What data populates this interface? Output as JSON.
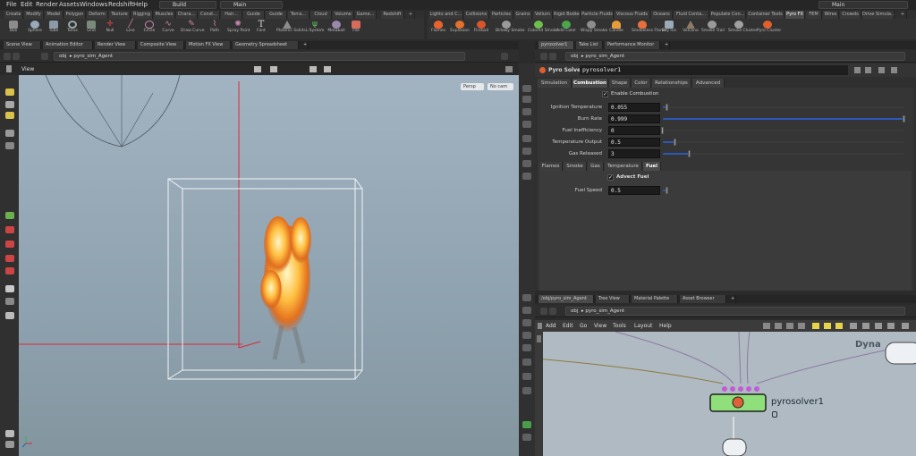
{
  "menubar": {
    "items": [
      "File",
      "Edit",
      "Render",
      "Assets",
      "Windows",
      "Redshift",
      "Help"
    ],
    "desktop": "Build",
    "main_label": "Main",
    "right_main": "Main"
  },
  "shelf_tabs_left": [
    "Create",
    "Modify",
    "Model",
    "Polygon",
    "Deform",
    "Texture",
    "Rigging",
    "Muscles",
    "Chara...",
    "Const...",
    "Hair...",
    "Guide",
    "Guide",
    "Terra...",
    "Cloud",
    "Volume",
    "Game...",
    "Redshift"
  ],
  "shelf_tabs_right": [
    "Lights and C...",
    "Collisions",
    "Particles",
    "Grains",
    "Vellum",
    "Rigid Bodies",
    "Particle Fluids",
    "Viscous Fluids",
    "Oceans",
    "Fluid Conta...",
    "Populate Con...",
    "Container Tools",
    "Pyro FX",
    "FEM",
    "Wires",
    "Crowds",
    "Drive Simula..."
  ],
  "tools_left": [
    "Box",
    "Sphere",
    "Tube",
    "Torus",
    "Grid",
    "Null",
    "Line",
    "Circle",
    "Curve",
    "Draw Curve",
    "Path",
    "Spray Paint",
    "Font",
    "Platonic Solids",
    "L-System",
    "Metaball",
    "File"
  ],
  "tools_right": [
    "Flames",
    "Explosion",
    "Fireball",
    "Billowy Smoke",
    "Colored Smoke",
    "Add Color",
    "Wispy Smoke",
    "Candle",
    "Smokeless Flame",
    "Dry Ice",
    "Volcano",
    "Smoke Trail",
    "Smoke Cluster",
    "Pyro Cluster"
  ],
  "left_panel_tabs": [
    "Scene View",
    "Animation Editor",
    "Render View",
    "Composite View",
    "Motion FX View",
    "Geometry Spreadsheet"
  ],
  "right_panel_tabs": [
    "pyrosolver1",
    "Take List",
    "Performance Monitor"
  ],
  "left_path": {
    "obj": "obj",
    "node": "pyro_sim_Agent"
  },
  "right_path": {
    "obj": "obj",
    "node": "pyro_sim_Agent"
  },
  "viewport": {
    "title": "View",
    "persp": "Persp",
    "cam": "No cam"
  },
  "params": {
    "node_type": "Pyro Solver",
    "node_name": "pyrosolver1",
    "tabs": [
      "Simulation",
      "Combustion",
      "Shape",
      "Color",
      "Relationships",
      "Advanced"
    ],
    "active_tab": "Combustion",
    "enable_label": "Enable Combustion",
    "fields": [
      {
        "label": "Ignition Temperature",
        "value": "0.055",
        "fraction": 0.02
      },
      {
        "label": "Burn Rate",
        "value": "0.999",
        "fraction": 0.999
      },
      {
        "label": "Fuel Inefficiency",
        "value": "0",
        "fraction": 0
      },
      {
        "label": "Temperature Output",
        "value": "0.5",
        "fraction": 0.05
      },
      {
        "label": "Gas Released",
        "value": "3",
        "fraction": 0.11
      }
    ],
    "subtabs": [
      "Flames",
      "Smoke",
      "Gas",
      "Temperature",
      "Fuel"
    ],
    "active_subtab": "Fuel",
    "advect_label": "Advect Fuel",
    "fuel_speed": {
      "label": "Fuel Speed",
      "value": "0.5",
      "fraction": 0.02
    }
  },
  "network_tabs": [
    "/obj/pyro_sim_Agent",
    "Tree View",
    "Material Palette",
    "Asset Browser"
  ],
  "network_path": {
    "obj": "obj",
    "node": "pyro_sim_Agent"
  },
  "network_menu": [
    "Add",
    "Edit",
    "Go",
    "View",
    "Tools",
    "Layout",
    "Help"
  ],
  "network": {
    "node_label": "pyrosolver1",
    "corner_label": "Dyna"
  },
  "colors": {
    "node_green": "#8fe07a",
    "port_magenta": "#c35bd6",
    "accent_blue": "#2c59b8",
    "gizmo_red": "#d9293a"
  }
}
